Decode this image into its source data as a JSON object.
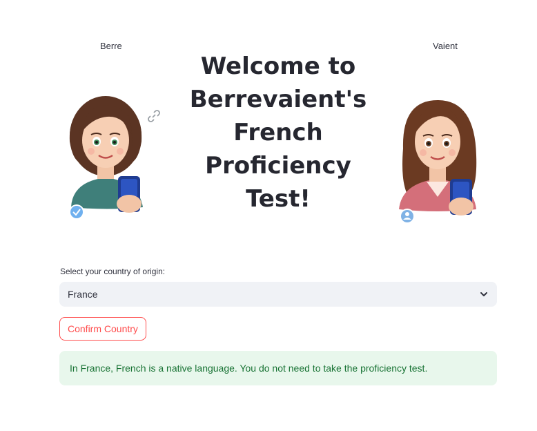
{
  "columns": {
    "left_caption": "Berre",
    "right_caption": "Vaient"
  },
  "title": "Welcome to Berrevaient's French Proficiency Test!",
  "form": {
    "select_label": "Select your country of origin:",
    "selected_country": "France",
    "confirm_label": "Confirm Country"
  },
  "alert": {
    "message": "In France, French is a native language. You do not need to take the proficiency test."
  },
  "colors": {
    "accent": "#ff4b4b",
    "success_bg": "#e8f7ec",
    "success_text": "#177233",
    "select_bg": "#f0f2f6"
  },
  "icons": {
    "link": "link-icon",
    "verified": "check-badge-icon",
    "user": "user-badge-icon",
    "dropdown": "chevron-down-icon"
  }
}
